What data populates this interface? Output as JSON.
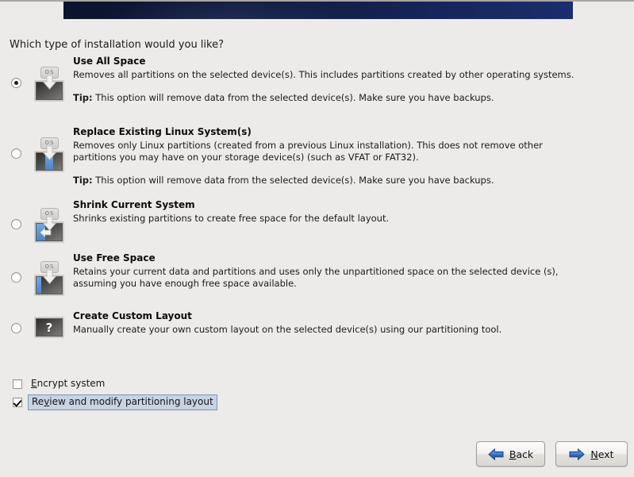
{
  "window": {
    "title": "Which type of installation would you like?"
  },
  "header": {
    "banner_color_left": "#0c132c",
    "banner_color_right": "#1b2d6b"
  },
  "question": "Which type of installation would you like?",
  "options": [
    {
      "id": "use-all-space",
      "title": "Use All Space",
      "description": "Removes all partitions on the selected device(s).  This includes partitions created by other operating systems.",
      "tip_label": "Tip:",
      "tip": "This option will remove data from the selected device(s).  Make sure you have backups.",
      "selected": true,
      "icon": "disk-use-all-space-icon",
      "icon_tab_label": "OS"
    },
    {
      "id": "replace-existing-linux",
      "title": "Replace Existing Linux System(s)",
      "description": "Removes only Linux partitions (created from a previous Linux installation).  This does not remove other partitions you may have on your storage device(s) (such as VFAT or FAT32).",
      "tip_label": "Tip:",
      "tip": "This option will remove data from the selected device(s).  Make sure you have backups.",
      "selected": false,
      "icon": "disk-replace-existing-icon",
      "icon_tab_label": "OS"
    },
    {
      "id": "shrink-current-system",
      "title": "Shrink Current System",
      "description": "Shrinks existing partitions to create free space for the default layout.",
      "tip_label": "",
      "tip": "",
      "selected": false,
      "icon": "disk-shrink-icon",
      "icon_tab_label": "OS"
    },
    {
      "id": "use-free-space",
      "title": "Use Free Space",
      "description": "Retains your current data and partitions and uses only the unpartitioned space on the selected device (s), assuming you have enough free space available.",
      "tip_label": "",
      "tip": "",
      "selected": false,
      "icon": "disk-use-free-space-icon",
      "icon_tab_label": "OS"
    },
    {
      "id": "create-custom-layout",
      "title": "Create Custom Layout",
      "description": "Manually create your own custom layout on the selected device(s) using our partitioning tool.",
      "tip_label": "",
      "tip": "",
      "selected": false,
      "icon": "disk-custom-layout-icon",
      "icon_tab_label": "?"
    }
  ],
  "checkboxes": [
    {
      "id": "encrypt-system",
      "mnemonic": "E",
      "rest": "ncrypt system",
      "checked": false,
      "focused": false
    },
    {
      "id": "review-modify-partitioning",
      "prefix": "Re",
      "mnemonic": "v",
      "rest": "iew and modify partitioning layout",
      "checked": true,
      "focused": true
    }
  ],
  "buttons": {
    "back": {
      "mnemonic": "B",
      "rest": "ack",
      "icon": "arrow-left-icon"
    },
    "next": {
      "mnemonic": "N",
      "rest": "ext",
      "icon": "arrow-right-icon"
    }
  }
}
